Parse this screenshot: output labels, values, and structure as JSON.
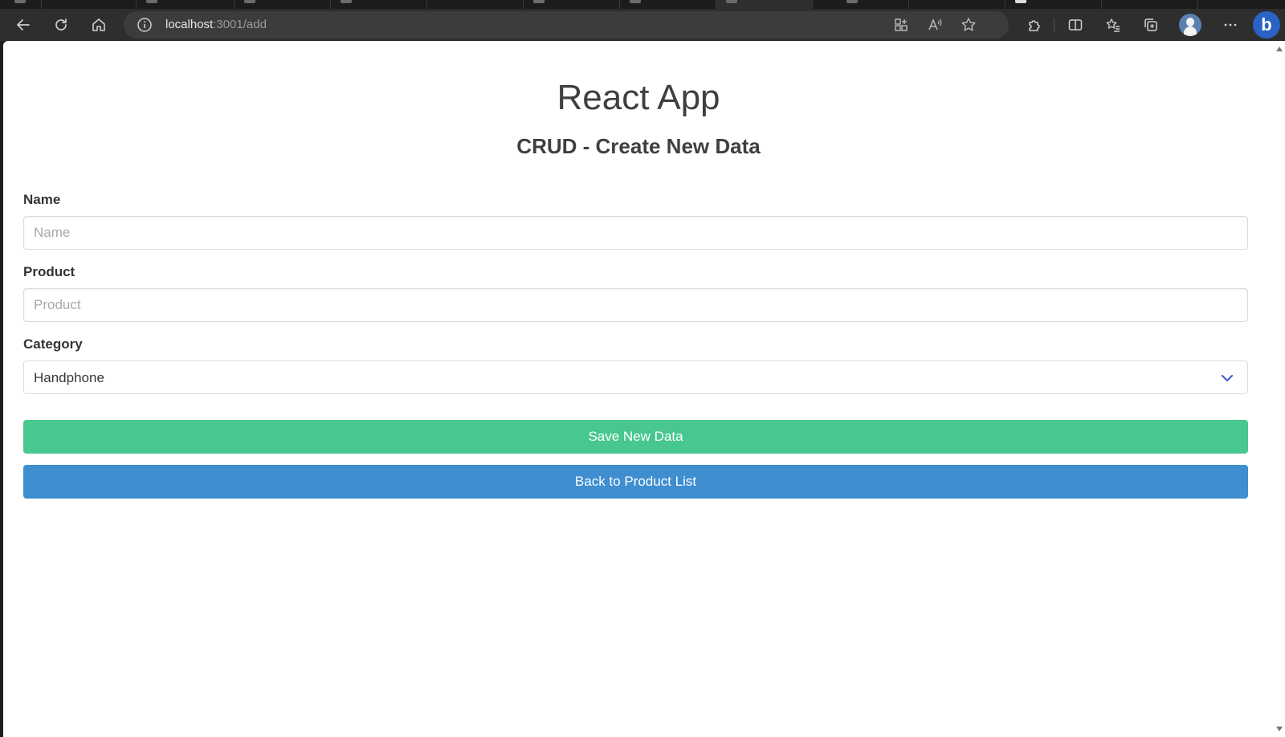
{
  "browser": {
    "url_host": "localhost",
    "url_path": ":3001/add"
  },
  "page": {
    "title": "React App",
    "subtitle": "CRUD - Create New Data"
  },
  "form": {
    "name": {
      "label": "Name",
      "value": "",
      "placeholder": "Name"
    },
    "product": {
      "label": "Product",
      "value": "",
      "placeholder": "Product"
    },
    "category": {
      "label": "Category",
      "selected": "Handphone"
    },
    "save_label": "Save New Data",
    "back_label": "Back to Product List"
  },
  "colors": {
    "save_button": "#48c78e",
    "back_button": "#3e8ed0",
    "select_chevron": "#485fc7"
  }
}
